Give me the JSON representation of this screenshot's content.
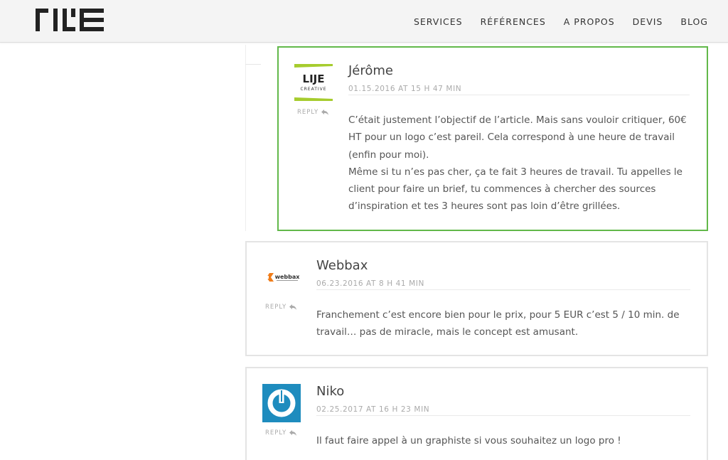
{
  "site": {
    "logo_alt": "LIJE"
  },
  "nav": {
    "items": [
      "SERVICES",
      "RÉFÉRENCES",
      "A PROPOS",
      "DEVIS",
      "BLOG"
    ]
  },
  "comments": [
    {
      "author": "Jérôme",
      "date": "01.15.2016 AT 15 H 47 MIN",
      "reply_label": "REPLY",
      "avatar": "lije-creative-logo",
      "avatar_text": "LIJE",
      "avatar_subtext": "CREATIVE",
      "body_lines": [
        "C’était justement l’objectif de l’article. Mais sans vouloir critiquer, 60€",
        "HT pour un logo c’est pareil. Cela correspond à une heure de travail",
        "(enfin pour moi).",
        "Même si tu n’es pas cher, ça te fait 3 heures de travail. Tu appelles le",
        "client pour faire un brief, tu commences à chercher des sources",
        "d’inspiration et tes 3 heures sont pas loin d’être grillées."
      ]
    },
    {
      "author": "Webbax",
      "date": "06.23.2016 AT 8 H 41 MIN",
      "reply_label": "REPLY",
      "avatar": "webbax-logo",
      "avatar_text": "webbax",
      "body_lines": [
        "Franchement c’est encore bien pour le prix, pour 5 EUR c’est 5 / 10 min. de",
        "travail… pas de miracle, mais le concept est amusant."
      ]
    },
    {
      "author": "Niko",
      "date": "02.25.2017 AT 16 H 23 MIN",
      "reply_label": "REPLY",
      "avatar": "gravatar-default",
      "body_lines": [
        "Il faut faire appel à un graphiste si vous souhaitez un logo pro !"
      ]
    }
  ],
  "colors": {
    "highlight_border": "#62b84a",
    "lije_green": "#a6cc2e",
    "webbax_orange": "#f07d1a",
    "gravatar_blue": "#1e8cbe"
  }
}
